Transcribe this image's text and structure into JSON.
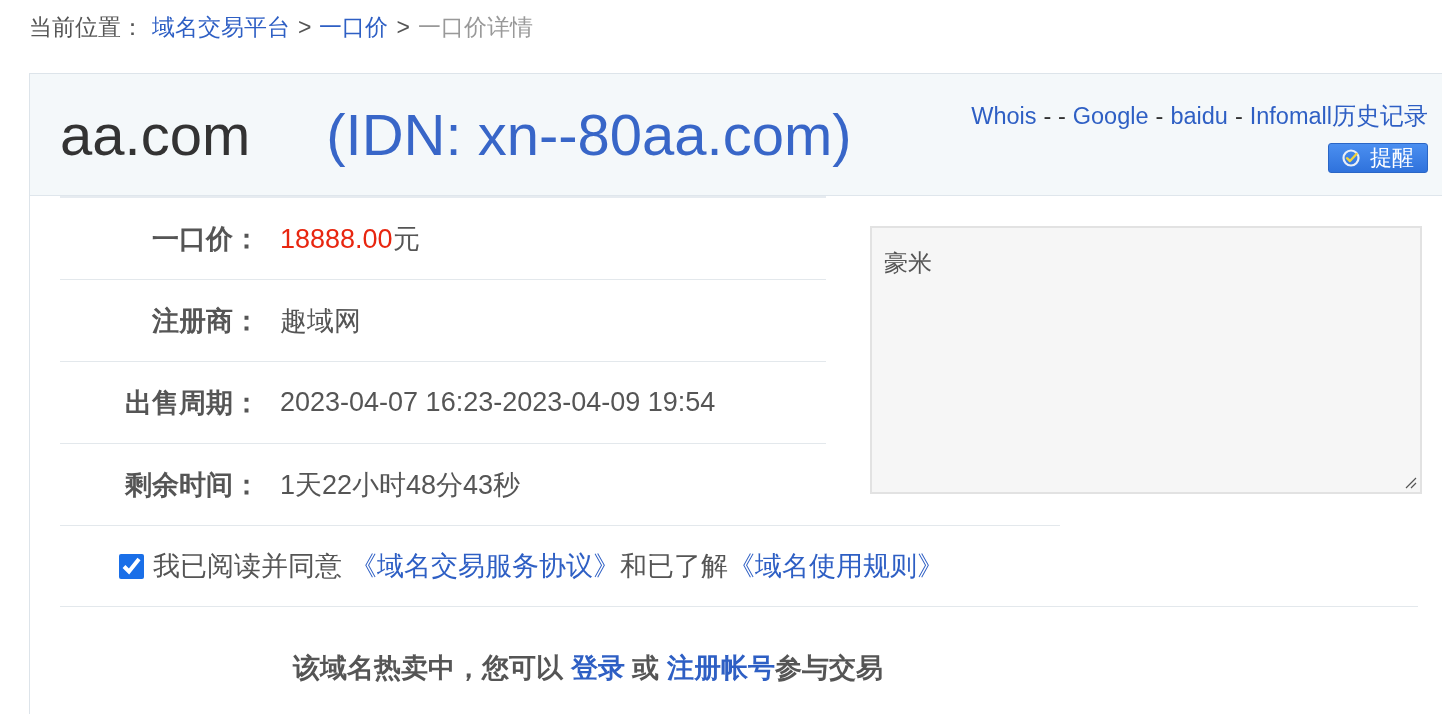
{
  "breadcrumb": {
    "label": "当前位置：",
    "items": [
      {
        "kind": "link",
        "text": "域名交易平台"
      },
      {
        "kind": "separator",
        "text": ">"
      },
      {
        "kind": "link",
        "text": "一口价"
      },
      {
        "kind": "separator",
        "text": ">"
      },
      {
        "kind": "current",
        "text": "一口价详情"
      }
    ]
  },
  "header": {
    "domain": "aa.com",
    "idn": "(IDN: xn--80aa.com)",
    "links": [
      {
        "kind": "link",
        "text": "Whois"
      },
      {
        "kind": "separator",
        "text": "- -"
      },
      {
        "kind": "link",
        "text": "Google"
      },
      {
        "kind": "separator",
        "text": "-"
      },
      {
        "kind": "link",
        "text": "baidu"
      },
      {
        "kind": "separator",
        "text": "-"
      },
      {
        "kind": "link",
        "text": "Infomall历史记录"
      }
    ],
    "remind_button": "提醒"
  },
  "details": [
    {
      "kind": "price",
      "label": "一口价：",
      "value": "18888.00",
      "unit": "元"
    },
    {
      "kind": "text",
      "label": "注册商：",
      "value": "趣域网"
    },
    {
      "kind": "text",
      "label": "出售周期：",
      "value": "2023-04-07 16:23-2023-04-09 19:54"
    },
    {
      "kind": "text",
      "label": "剩余时间：",
      "value": "1天22小时48分43秒"
    }
  ],
  "note": {
    "value": "豪米"
  },
  "agreement": {
    "checked": true,
    "parts": [
      {
        "kind": "text",
        "text": "我已阅读并同意 "
      },
      {
        "kind": "link",
        "text": "《域名交易服务协议》"
      },
      {
        "kind": "text",
        "text": "和已了解"
      },
      {
        "kind": "link",
        "text": "《域名使用规则》"
      }
    ]
  },
  "notice": {
    "parts": [
      {
        "kind": "text",
        "text": "该域名热卖中，您可以 "
      },
      {
        "kind": "link",
        "text": "登录"
      },
      {
        "kind": "text",
        "text": " 或 "
      },
      {
        "kind": "link",
        "text": "注册帐号"
      },
      {
        "kind": "text",
        "text": "参与交易"
      }
    ]
  }
}
